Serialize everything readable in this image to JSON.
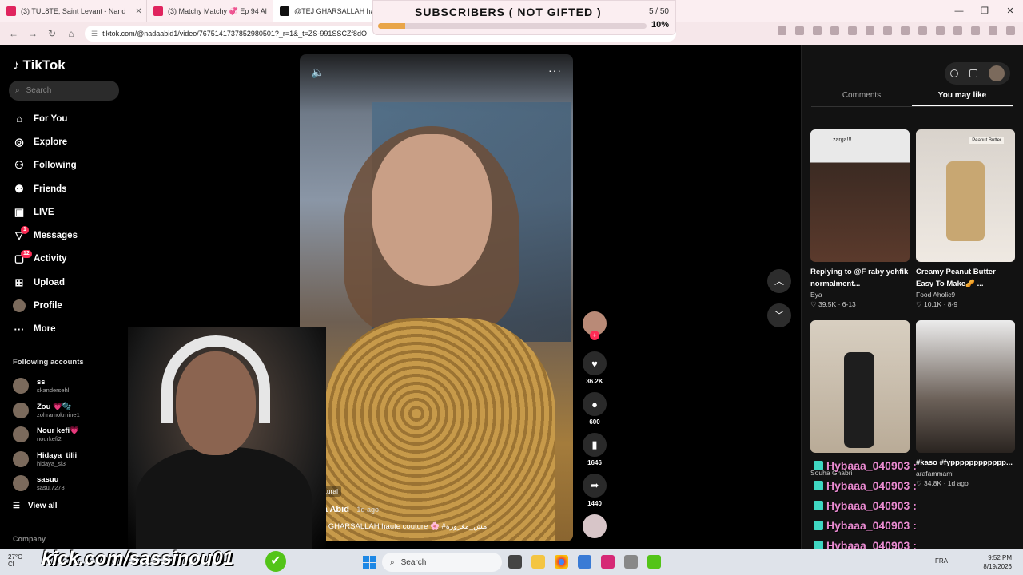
{
  "browser": {
    "tabs": [
      {
        "label": "(3) TUL8TE, Saint Levant - Nand"
      },
      {
        "label": "(3) Matchy Matchy 💞 Ep 94 Al"
      },
      {
        "label": "@TEJ GHARSALLAH haute c"
      }
    ],
    "url": "tiktok.com/@nadaabid1/video/7675141737852980501?_r=1&_t=ZS-991SSCZf8dO",
    "window_controls": [
      "—",
      "❐",
      "✕"
    ]
  },
  "subscribers_overlay": {
    "title": "SUBSCRIBERS ( NOT GIFTED )",
    "count": "5 / 50",
    "percent_label": "10%",
    "progress_fraction": 0.1,
    "bar_color": "#e9a548"
  },
  "sidebar": {
    "logo": "TikTok",
    "search_placeholder": "Search",
    "nav": [
      {
        "label": "For You",
        "icon": "home-icon"
      },
      {
        "label": "Explore",
        "icon": "compass-icon"
      },
      {
        "label": "Following",
        "icon": "following-icon"
      },
      {
        "label": "Friends",
        "icon": "friends-icon"
      },
      {
        "label": "LIVE",
        "icon": "live-icon"
      },
      {
        "label": "Messages",
        "icon": "messages-icon",
        "badge": "1"
      },
      {
        "label": "Activity",
        "icon": "activity-icon",
        "badge": "12"
      },
      {
        "label": "Upload",
        "icon": "upload-icon"
      },
      {
        "label": "Profile",
        "icon": "profile-avatar"
      },
      {
        "label": "More",
        "icon": "more-icon"
      }
    ],
    "following_heading": "Following accounts",
    "following": [
      {
        "name": "ss",
        "user": "skandersehli"
      },
      {
        "name": "Zou 💗🫧",
        "user": "zohramokrnine1"
      },
      {
        "name": "Nour kefi💗",
        "user": "nourkefi2"
      },
      {
        "name": "Hidaya_tilii",
        "user": "hidaya_sl3"
      },
      {
        "name": "sasuu",
        "user": "sasu.7278"
      }
    ],
    "view_all": "View all",
    "company": "Company"
  },
  "video": {
    "tag": "natural",
    "author": "da Abid",
    "time": "· 1d ago",
    "description": "EJ GHARSALLAH haute couture 🌸 #مش_مغرورة"
  },
  "actions": {
    "likes": "36.2K",
    "comments": "600",
    "saves": "1646",
    "shares": "1440"
  },
  "right_panel": {
    "tabs": [
      "Comments",
      "You may like"
    ],
    "active_tab": "You may like",
    "cards": [
      {
        "title": "Replying to @F raby ychfik normalment...",
        "author": "Eya",
        "likes": "39.5K",
        "date": "6-13",
        "overlay": "zarga!!!"
      },
      {
        "title": "Creamy Peanut Butter Easy To Make🥜 ...",
        "author": "Food Aholic9",
        "likes": "10.1K",
        "date": "8-9",
        "overlay": "Peanut Butter"
      },
      {
        "title": "",
        "author": "Souha Ghabri",
        "likes": "",
        "date": ""
      },
      {
        "title": "#kaso #fypppppppppppp...",
        "author": "arafammami",
        "likes": "34.8K",
        "date": "1d ago"
      }
    ]
  },
  "stream_overlay": {
    "kick_text": "kick.com/sassinou01",
    "chat_user": "Hybaaa_040903",
    "chat_lines": [
      "Hybaaa_040903 :",
      "Hybaaa_040903 :",
      "Hybaaa_040903 :",
      "Hybaaa_040903 :",
      "Hybaaa_040903 :",
      "Hybaaa_040903 :"
    ]
  },
  "taskbar": {
    "weather_temp": "27°C",
    "weather_text": "Cl",
    "search": "Search",
    "time": "9:52 PM",
    "date": "8/19/2026",
    "lang": "FRA"
  }
}
